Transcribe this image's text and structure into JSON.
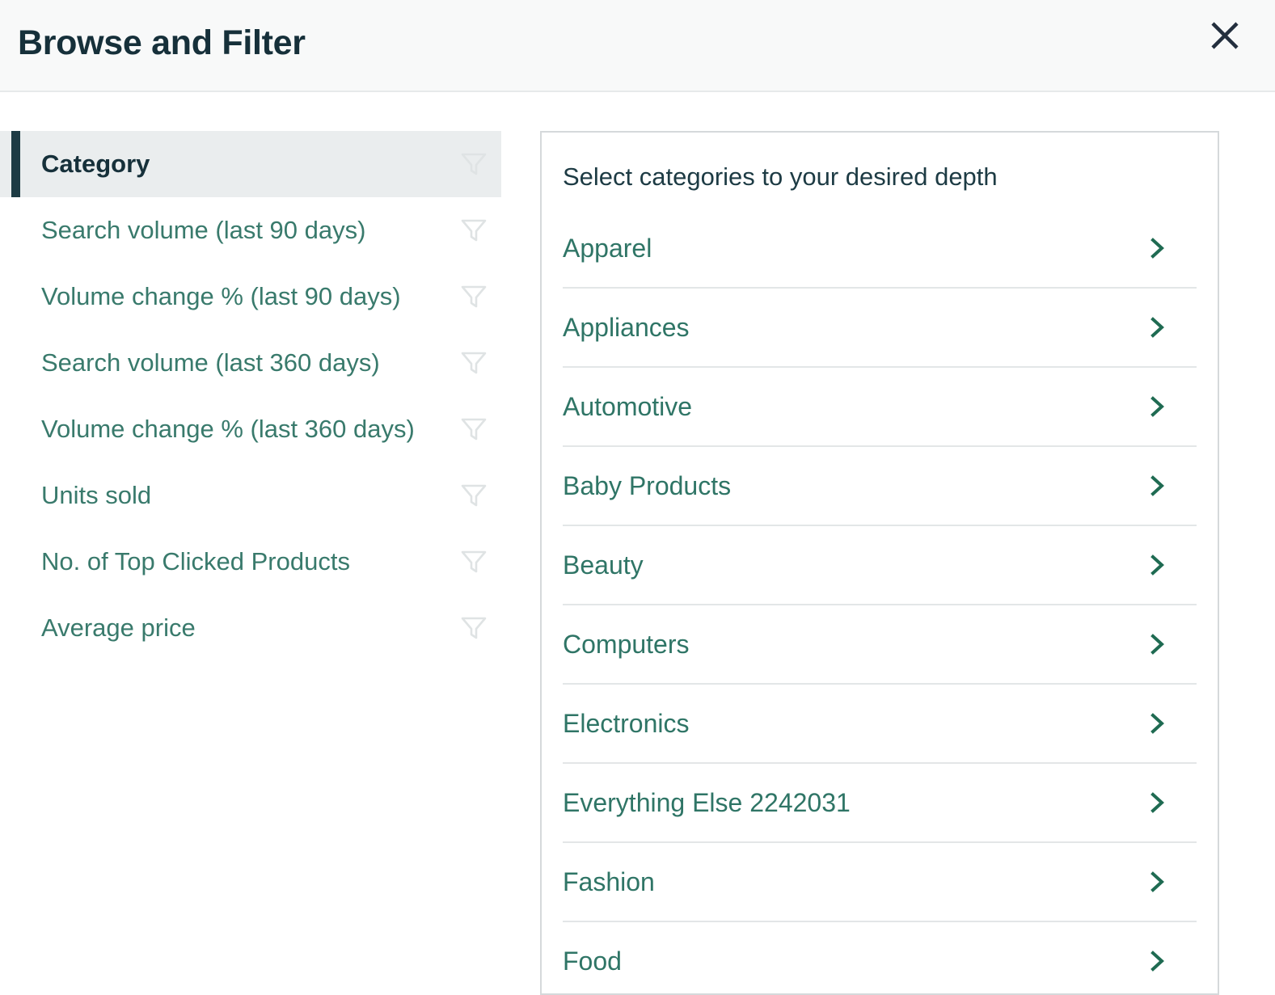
{
  "header": {
    "title": "Browse and Filter",
    "close_icon": "close-icon"
  },
  "sidebar": {
    "items": [
      {
        "label": "Category",
        "selected": true,
        "icon": "filter-funnel-icon"
      },
      {
        "label": "Search volume (last 90 days)",
        "selected": false,
        "icon": "filter-funnel-icon"
      },
      {
        "label": "Volume change % (last 90 days)",
        "selected": false,
        "icon": "filter-funnel-icon"
      },
      {
        "label": "Search volume (last 360 days)",
        "selected": false,
        "icon": "filter-funnel-icon"
      },
      {
        "label": "Volume change % (last 360 days)",
        "selected": false,
        "icon": "filter-funnel-icon"
      },
      {
        "label": "Units sold",
        "selected": false,
        "icon": "filter-funnel-icon"
      },
      {
        "label": "No. of Top Clicked Products",
        "selected": false,
        "icon": "filter-funnel-icon"
      },
      {
        "label": "Average price",
        "selected": false,
        "icon": "filter-funnel-icon"
      }
    ]
  },
  "panel": {
    "heading": "Select categories to your desired depth",
    "categories": [
      {
        "label": "Apparel",
        "icon": "chevron-right-icon"
      },
      {
        "label": "Appliances",
        "icon": "chevron-right-icon"
      },
      {
        "label": "Automotive",
        "icon": "chevron-right-icon"
      },
      {
        "label": "Baby Products",
        "icon": "chevron-right-icon"
      },
      {
        "label": "Beauty",
        "icon": "chevron-right-icon"
      },
      {
        "label": "Computers",
        "icon": "chevron-right-icon"
      },
      {
        "label": "Electronics",
        "icon": "chevron-right-icon"
      },
      {
        "label": "Everything Else 2242031",
        "icon": "chevron-right-icon"
      },
      {
        "label": "Fashion",
        "icon": "chevron-right-icon"
      },
      {
        "label": "Food",
        "icon": "chevron-right-icon"
      }
    ]
  },
  "colors": {
    "accent_bar": "#1d3b44",
    "link_teal": "#2f7566",
    "sidebar_link": "#397a6c",
    "title_dark": "#16303a",
    "header_bg": "#f8f9f9",
    "selected_row_bg": "#eaedee",
    "panel_border": "#d5d9db",
    "divider": "#e3e6e7",
    "funnel_icon": "#e4e7e8"
  }
}
